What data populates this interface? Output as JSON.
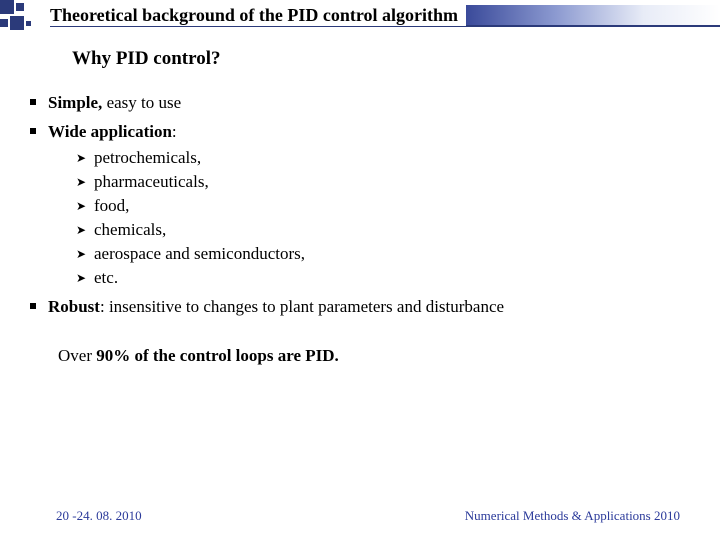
{
  "title": "Theoretical background of the PID control algorithm",
  "subtitle": "Why PID control?",
  "bullets": [
    {
      "lead": "Simple, ",
      "rest": "easy to use"
    },
    {
      "lead": "Wide application",
      "rest": ":",
      "sub": [
        "petrochemicals,",
        "pharmaceuticals,",
        "food,",
        "chemicals,",
        "aerospace and semiconductors,",
        "etc."
      ]
    },
    {
      "lead": "Robust",
      "rest": ": insensitive to changes to plant parameters and disturbance"
    }
  ],
  "statement": {
    "pre": "Over ",
    "highlight": "90% of the control loops are PID.",
    "post": ""
  },
  "footer": {
    "left": "20 -24. 08. 2010",
    "right": "Numerical Methods & Applications 2010"
  }
}
